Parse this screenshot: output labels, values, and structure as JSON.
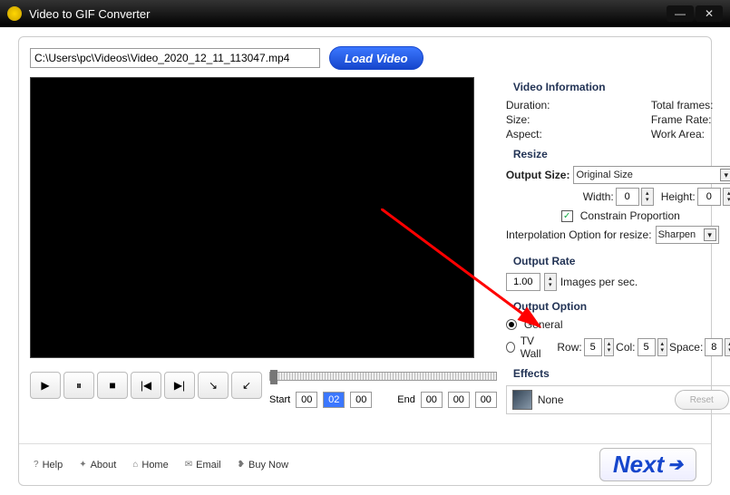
{
  "titlebar": {
    "title": "Video to GIF Converter"
  },
  "path": "C:\\Users\\pc\\Videos\\Video_2020_12_11_113047.mp4",
  "load_label": "Load Video",
  "info": {
    "heading": "Video Information",
    "duration_label": "Duration:",
    "duration": "",
    "totalframes_label": "Total frames:",
    "totalframes": "",
    "size_label": "Size:",
    "size": "",
    "framerate_label": "Frame Rate:",
    "framerate": "",
    "aspect_label": "Aspect:",
    "aspect": "",
    "workarea_label": "Work Area:",
    "workarea": ""
  },
  "resize": {
    "heading": "Resize",
    "output_size_label": "Output Size:",
    "output_size": "Original Size",
    "width_label": "Width:",
    "width": "0",
    "height_label": "Height:",
    "height": "0",
    "constrain": "Constrain Proportion",
    "interp_label": "Interpolation Option for resize:",
    "interp": "Sharpen"
  },
  "rate": {
    "heading": "Output Rate",
    "value": "1.00",
    "suffix": "Images per sec."
  },
  "option": {
    "heading": "Output Option",
    "general": "General",
    "tvwall": "TV Wall",
    "row_label": "Row:",
    "row": "5",
    "col_label": "Col:",
    "col": "5",
    "space_label": "Space:",
    "space": "8"
  },
  "effects": {
    "heading": "Effects",
    "value": "None",
    "reset": "Reset"
  },
  "time": {
    "start_label": "Start",
    "end_label": "End",
    "s1": "00",
    "s2": "02",
    "s3": "00",
    "e1": "00",
    "e2": "00",
    "e3": "00"
  },
  "footer": {
    "help": "Help",
    "about": "About",
    "home": "Home",
    "email": "Email",
    "buy": "Buy Now",
    "next": "Next"
  }
}
